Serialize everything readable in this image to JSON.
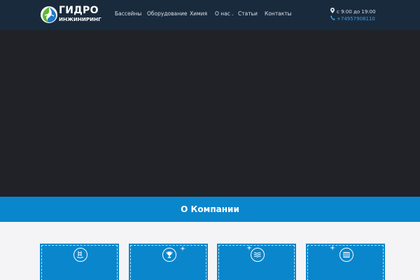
{
  "header": {
    "logo": {
      "line1": "ГИДРО",
      "line2": "ИНЖИНИРИНГ"
    },
    "nav": [
      {
        "label": "Бассейны",
        "has_dropdown": false
      },
      {
        "label": "Оборудование",
        "has_dropdown": false
      },
      {
        "label": "Химия",
        "has_dropdown": false
      },
      {
        "label": "О нас",
        "has_dropdown": true
      },
      {
        "label": "Статьи",
        "has_dropdown": false
      },
      {
        "label": "Контакты",
        "has_dropdown": false
      }
    ],
    "contact": {
      "hours": "с 9:00 до 19:00",
      "phone": "+74957908110",
      "hours_icon": "map-pin-icon",
      "phone_icon": "phone-icon"
    }
  },
  "about": {
    "title": "О Компании"
  },
  "cards": [
    {
      "icon": "pool-ladder-icon"
    },
    {
      "icon": "trophy-icon"
    },
    {
      "icon": "water-waves-icon"
    },
    {
      "icon": "filter-grid-icon"
    }
  ],
  "colors": {
    "header_bg": "#1a2a3d",
    "hero_bg": "#202228",
    "accent_blue": "#0a86cc",
    "phone_link": "#3f9fe0",
    "logo_green": "#5cb82e",
    "logo_blue": "#1f79c6"
  }
}
